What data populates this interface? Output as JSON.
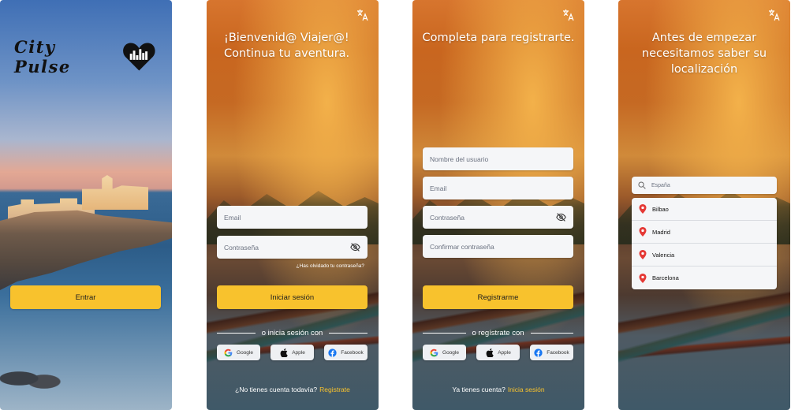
{
  "screen1": {
    "logo_text": "City Pulse",
    "enter_label": "Entrar"
  },
  "screen2": {
    "heading": "¡Bienvenid@ Viajer@! Continua tu aventura.",
    "email_placeholder": "Email",
    "password_placeholder": "Contraseña",
    "forgot_label": "¿Has olvidado tu contraseña?",
    "login_label": "Iniciar sesión",
    "divider_label": "o inicia sesión con",
    "google_label": "Google",
    "apple_label": "Apple",
    "facebook_label": "Facebook",
    "footer_text": "¿No tienes cuenta todavía?",
    "footer_link": "Registrate"
  },
  "screen3": {
    "heading": "Completa para registrarte.",
    "username_placeholder": "Nombre del usuario",
    "email_placeholder": "Email",
    "password_placeholder": "Contraseña",
    "confirm_placeholder": "Confirmar contraseña",
    "register_label": "Registrarme",
    "divider_label": "o regístrate con",
    "google_label": "Google",
    "apple_label": "Apple",
    "facebook_label": "Facebook",
    "footer_text": "Ya tienes cuenta?",
    "footer_link": "Inicia sesión"
  },
  "screen4": {
    "heading": "Antes de empezar necesitamos saber su localización",
    "search_value": "España",
    "results": [
      "Bilbao",
      "Madrid",
      "Valencia",
      "Barcelona"
    ]
  },
  "colors": {
    "accent": "#f8c22d",
    "pin": "#e53935"
  },
  "icons": {
    "translate": "translate-icon",
    "eye_off": "eye-off-icon",
    "search": "search-icon",
    "pin": "location-pin-icon"
  }
}
